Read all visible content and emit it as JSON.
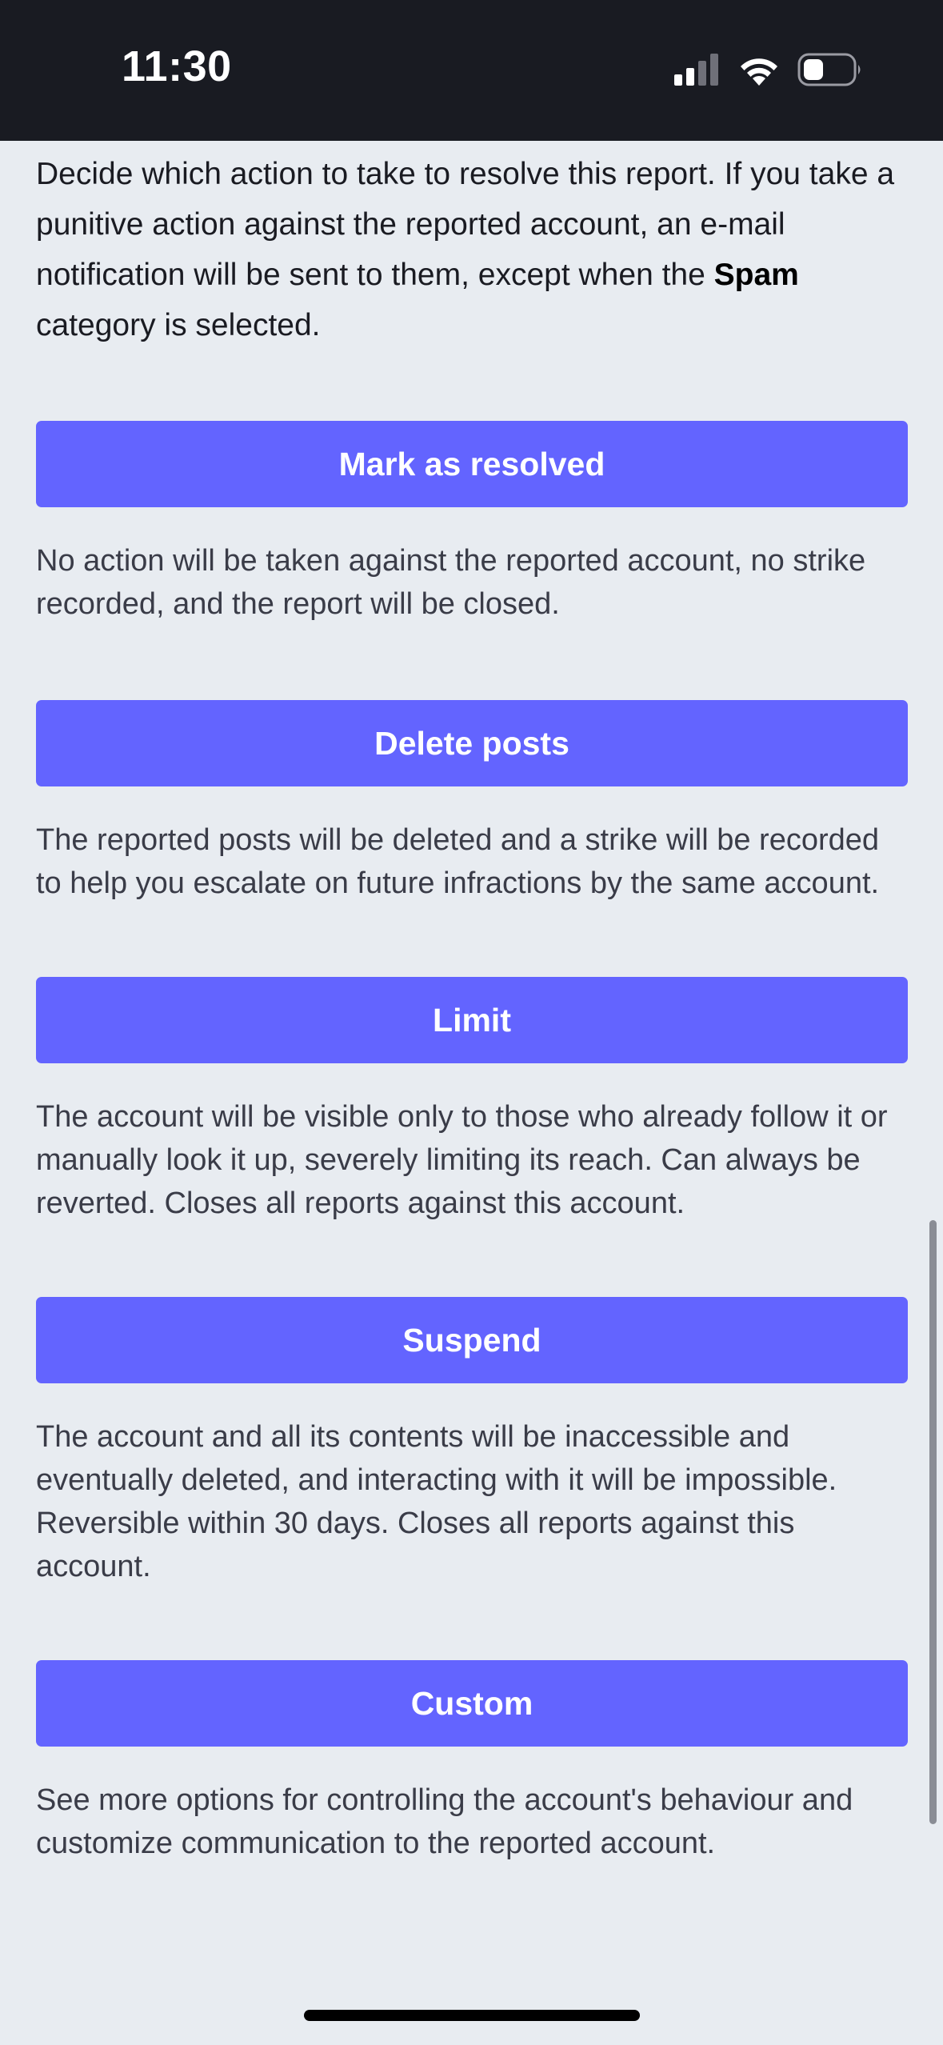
{
  "status_bar": {
    "time": "11:30",
    "signal_icon": "cellular-signal-icon",
    "wifi_icon": "wifi-icon",
    "battery_icon": "battery-icon"
  },
  "intro": {
    "text_before": "Decide which action to take to resolve this report. If you take a punitive action against the reported account, an e-mail notification will be sent to them, except when the ",
    "bold": "Spam",
    "text_after": " category is selected."
  },
  "actions": [
    {
      "label": "Mark as resolved",
      "description": "No action will be taken against the reported account, no strike recorded, and the report will be closed."
    },
    {
      "label": "Delete posts",
      "description": "The reported posts will be deleted and a strike will be recorded to help you escalate on future infractions by the same account."
    },
    {
      "label": "Limit",
      "description": "The account will be visible only to those who already follow it or manually look it up, severely limiting its reach. Can always be reverted. Closes all reports against this account."
    },
    {
      "label": "Suspend",
      "description": "The account and all its contents will be inaccessible and eventually deleted, and interacting with it will be impossible. Reversible within 30 days. Closes all reports against this account."
    },
    {
      "label": "Custom",
      "description": "See more options for controlling the account's behaviour and customize communication to the reported account."
    }
  ],
  "colors": {
    "accent": "#6364ff",
    "background": "#e8ecf1",
    "status_bar": "#191b22"
  }
}
